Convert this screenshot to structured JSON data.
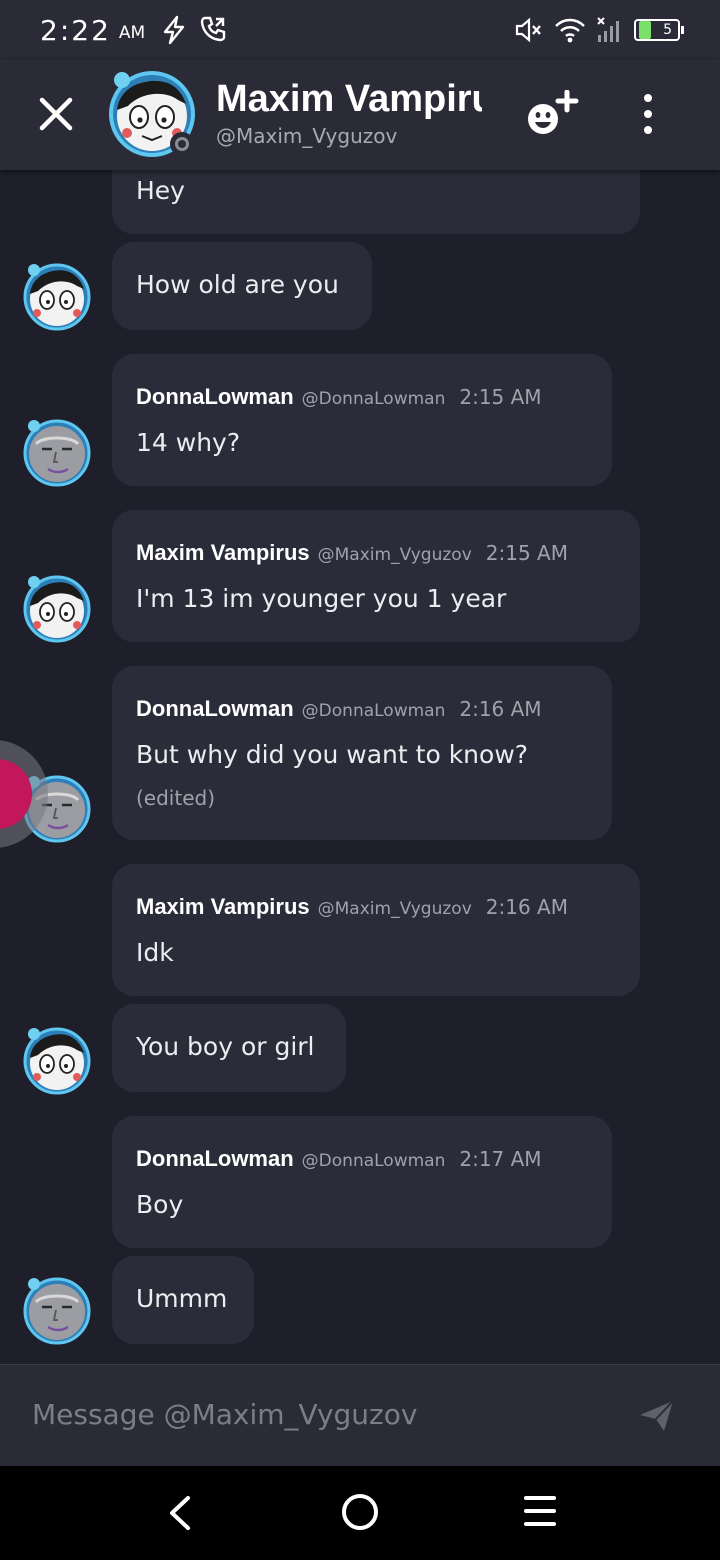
{
  "status_bar": {
    "time": "2:22",
    "ampm": "AM",
    "battery": "5"
  },
  "header": {
    "name": "Maxim Vampirus",
    "handle": "@Maxim_Vyguzov"
  },
  "messages": [
    {
      "type": "continuation",
      "text": "Hey"
    },
    {
      "type": "continuation",
      "text": "How old are you"
    },
    {
      "type": "message",
      "author": "DonnaLowman",
      "handle": "@DonnaLowman",
      "time": "2:15 AM",
      "text": "14 why?"
    },
    {
      "type": "message",
      "author": "Maxim Vampirus",
      "handle": "@Maxim_Vyguzov",
      "time": "2:15 AM",
      "text": "I'm 13 im younger you 1 year"
    },
    {
      "type": "message",
      "author": "DonnaLowman",
      "handle": "@DonnaLowman",
      "time": "2:16 AM",
      "text": "But why did you want to know?",
      "edited": "(edited)"
    },
    {
      "type": "message",
      "author": "Maxim Vampirus",
      "handle": "@Maxim_Vyguzov",
      "time": "2:16 AM",
      "text": "Idk"
    },
    {
      "type": "continuation",
      "text": "You boy or girl"
    },
    {
      "type": "message",
      "author": "DonnaLowman",
      "handle": "@DonnaLowman",
      "time": "2:17 AM",
      "text": "Boy"
    },
    {
      "type": "continuation",
      "text": "Ummm"
    }
  ],
  "composer": {
    "placeholder": "Message @Maxim_Vyguzov"
  },
  "colors": {
    "background": "#1e1f2b",
    "bubble": "#2b2c39",
    "header": "#2a2b37",
    "fab": "#c2185b"
  }
}
